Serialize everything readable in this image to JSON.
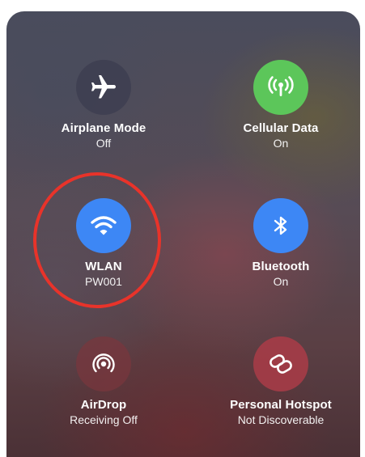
{
  "control_center": {
    "tiles": [
      {
        "label": "Airplane Mode",
        "status": "Off",
        "icon": "airplane-icon",
        "color": "#3c3e50",
        "active": false
      },
      {
        "label": "Cellular Data",
        "status": "On",
        "icon": "cellular-antenna-icon",
        "color": "#5cc65a",
        "active": true
      },
      {
        "label": "WLAN",
        "status": "PW001",
        "icon": "wifi-icon",
        "color": "#3d87f5",
        "active": true
      },
      {
        "label": "Bluetooth",
        "status": "On",
        "icon": "bluetooth-icon",
        "color": "#3d87f5",
        "active": true
      },
      {
        "label": "AirDrop",
        "status": "Receiving Off",
        "icon": "airdrop-icon",
        "color": "#78373e",
        "active": false
      },
      {
        "label": "Personal Hotspot",
        "status": "Not Discoverable",
        "icon": "hotspot-link-icon",
        "color": "#aa3c48",
        "active": false
      }
    ],
    "annotation": {
      "color": "#e8332a",
      "target": "WLAN"
    }
  }
}
